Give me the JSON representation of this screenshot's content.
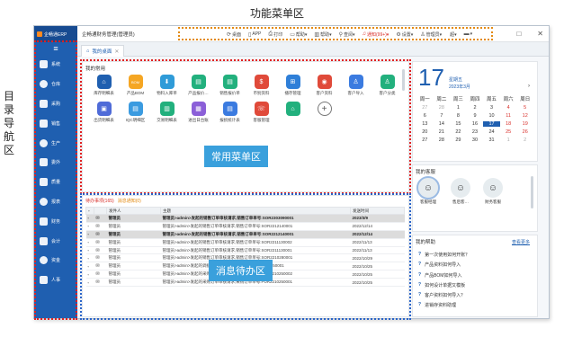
{
  "annotations": {
    "top_label": "功能菜单区",
    "left_label": "目录导航区",
    "common_menu_label": "常用菜单区",
    "message_label": "消息待办区"
  },
  "colors": {
    "sidebar": "#1f5fb0",
    "accent": "#1f5fb0",
    "overlay": "#3aa0dc",
    "highlight_row": "#dcdcdc",
    "red_border": "#e02020",
    "orange_border": "#e38a10",
    "blue_border": "#2a64c8"
  },
  "app_title": "企畅通ERP",
  "window_title": "企畅通财务管理(管理员)",
  "function_menu": [
    {
      "icon": "refresh-icon",
      "glyph": "⟳",
      "label": "桌面"
    },
    {
      "icon": "phone-icon",
      "glyph": "▯",
      "label": "APP"
    },
    {
      "icon": "printer-icon",
      "glyph": "⎙",
      "label": "打印"
    },
    {
      "icon": "folder-icon",
      "glyph": "▭",
      "label": "帮助▾"
    },
    {
      "icon": "chart-icon",
      "glyph": "▥",
      "label": "帮助▾"
    },
    {
      "icon": "search-icon",
      "glyph": "⚲",
      "label": "查阅▾"
    },
    {
      "icon": "bell-icon",
      "glyph": "♫",
      "label": "通知(99+)▾",
      "accent": true
    },
    {
      "icon": "gear-icon",
      "glyph": "⚙",
      "label": "设置▾"
    },
    {
      "icon": "user-icon",
      "glyph": "♙",
      "label": "管理员▾"
    },
    {
      "icon": "ellipsis-icon",
      "glyph": "",
      "label": "超▾"
    },
    {
      "icon": "flag-icon",
      "glyph": "▬",
      "label": "▾"
    }
  ],
  "window_controls": [
    "□",
    "✕"
  ],
  "sidebar": {
    "toggle": "≡",
    "items": [
      {
        "label": "系统",
        "icon": "system-icon"
      },
      {
        "label": "仓库",
        "icon": "warehouse-icon"
      },
      {
        "label": "采购",
        "icon": "purchase-icon"
      },
      {
        "label": "销售",
        "icon": "sales-icon"
      },
      {
        "label": "生产",
        "icon": "production-icon"
      },
      {
        "label": "委外",
        "icon": "outsource-icon"
      },
      {
        "label": "质量",
        "icon": "quality-icon"
      },
      {
        "label": "报表",
        "icon": "report-icon"
      },
      {
        "label": "财务",
        "icon": "finance-icon"
      },
      {
        "label": "会计",
        "icon": "accounting-icon"
      },
      {
        "label": "资金",
        "icon": "funds-icon"
      },
      {
        "label": "人事",
        "icon": "hr-icon"
      }
    ]
  },
  "tab": {
    "label": "我的桌面",
    "close": "✕"
  },
  "common": {
    "title": "我的常用",
    "apps": [
      {
        "label": "库存明细表",
        "color": "#1f5fb0",
        "icon": "inventory-icon",
        "glyph": "⌂"
      },
      {
        "label": "产品BOM",
        "color": "#f5a623",
        "icon": "bom-icon",
        "glyph": "BOM"
      },
      {
        "label": "物料入库单",
        "color": "#2f9bd8",
        "icon": "inbound-icon",
        "glyph": "⬇"
      },
      {
        "label": "产品报价…",
        "color": "#22b07d",
        "icon": "quote-icon",
        "glyph": "▤"
      },
      {
        "label": "销售报价单",
        "color": "#22b07d",
        "icon": "sales-quote-icon",
        "glyph": "▤"
      },
      {
        "label": "币别资料",
        "color": "#e04a3a",
        "icon": "currency-icon",
        "glyph": "$"
      },
      {
        "label": "播存管理",
        "color": "#2f7fd8",
        "icon": "windows-icon",
        "glyph": "⊞"
      },
      {
        "label": "客户资料",
        "color": "#e04a3a",
        "icon": "customer-icon",
        "glyph": "◉"
      },
      {
        "label": "客户导入",
        "color": "#3b7be0",
        "icon": "import-icon",
        "glyph": "♙"
      },
      {
        "label": "客户分类",
        "color": "#22b07d",
        "icon": "category-icon",
        "glyph": "♙"
      },
      {
        "label": "出货明细表",
        "color": "#4f6bd8",
        "icon": "shipment-icon",
        "glyph": "▣"
      },
      {
        "label": "IQC明细区",
        "color": "#3b9be0",
        "icon": "iqc-icon",
        "glyph": "▤"
      },
      {
        "label": "交易明细表",
        "color": "#22b07d",
        "icon": "trade-icon",
        "glyph": "▥"
      },
      {
        "label": "进出日台账",
        "color": "#8b5fd8",
        "icon": "ledger-icon",
        "glyph": "▦"
      },
      {
        "label": "报损统计表",
        "color": "#3b7be0",
        "icon": "loss-icon",
        "glyph": "▤"
      },
      {
        "label": "客服管理",
        "color": "#e04a3a",
        "icon": "service-icon",
        "glyph": "☏"
      },
      {
        "label": "",
        "color": "#22b07d",
        "icon": "lock-icon",
        "glyph": "⌂"
      },
      {
        "label": "",
        "color": "",
        "icon": "add-icon",
        "glyph": "+"
      }
    ]
  },
  "messages": {
    "tabs": [
      "待办事项(165)",
      "消息通知(0)"
    ],
    "columns": [
      "",
      "发件人",
      "主题",
      "发送时间"
    ],
    "rows": [
      {
        "sender": "管理员",
        "subject": "管理员>admin>发起的销售订单审核请求,销售订单单号:SOR2303090001",
        "date": "2023/3/9",
        "highlight": true
      },
      {
        "sender": "管理员",
        "subject": "管理员>admin>发起的销售订单审核请求,销售订单单号:SOR2212140001",
        "date": "2022/12/14",
        "highlight": false
      },
      {
        "sender": "管理员",
        "subject": "管理员>admin>发起的销售订单审核请求,销售订单单号:SOR2212140001",
        "date": "2022/12/14",
        "highlight": true
      },
      {
        "sender": "管理员",
        "subject": "管理员>admin>发起的销售订单审核请求,销售订单单号:SOR2211130002",
        "date": "2022/11/13",
        "highlight": false
      },
      {
        "sender": "管理员",
        "subject": "管理员>admin>发起的销售订单审核请求,销售订单单号:SOR2211130001",
        "date": "2022/11/13",
        "highlight": false
      },
      {
        "sender": "管理员",
        "subject": "管理员>admin>发起的销售订单审核请求,销售订单单号:SOR2210280001",
        "date": "2022/10/29",
        "highlight": false
      },
      {
        "sender": "管理员",
        "subject": "管理员>admin>发起的调拨单审核请求,调拨单单号:PRK2210250001",
        "date": "2022/10/25",
        "highlight": false
      },
      {
        "sender": "管理员",
        "subject": "管理员>admin>发起的采购订单审核请求,采购订单单号:PUR2210250002",
        "date": "2022/10/25",
        "highlight": false
      },
      {
        "sender": "管理员",
        "subject": "管理员>admin>发起的采购订单审核请求,采购订单单号:PUR2210250001",
        "date": "2022/10/25",
        "highlight": false
      }
    ]
  },
  "calendar": {
    "day": "17",
    "weekday": "星期五",
    "year_month": "2023年3月",
    "next": "›",
    "headers": [
      "周一",
      "周二",
      "周三",
      "周四",
      "周五",
      "周六",
      "周日"
    ],
    "days": [
      [
        "27",
        "o"
      ],
      [
        "28",
        "o"
      ],
      [
        "1",
        ""
      ],
      [
        "2",
        ""
      ],
      [
        "3",
        ""
      ],
      [
        "4",
        "w"
      ],
      [
        "5",
        "w"
      ],
      [
        "6",
        ""
      ],
      [
        "7",
        ""
      ],
      [
        "8",
        ""
      ],
      [
        "9",
        ""
      ],
      [
        "10",
        ""
      ],
      [
        "11",
        "w"
      ],
      [
        "12",
        "w"
      ],
      [
        "13",
        ""
      ],
      [
        "14",
        ""
      ],
      [
        "15",
        ""
      ],
      [
        "16",
        ""
      ],
      [
        "17",
        "t"
      ],
      [
        "18",
        "w"
      ],
      [
        "19",
        "w"
      ],
      [
        "20",
        ""
      ],
      [
        "21",
        ""
      ],
      [
        "22",
        ""
      ],
      [
        "23",
        ""
      ],
      [
        "24",
        ""
      ],
      [
        "25",
        "w"
      ],
      [
        "26",
        "w"
      ],
      [
        "27",
        ""
      ],
      [
        "28",
        ""
      ],
      [
        "29",
        ""
      ],
      [
        "30",
        ""
      ],
      [
        "31",
        ""
      ],
      [
        "1",
        "o"
      ],
      [
        "2",
        "o"
      ]
    ]
  },
  "guests": {
    "title": "我的客服",
    "items": [
      {
        "name": "客服经理",
        "selected": true
      },
      {
        "name": "售后客…",
        "selected": false
      },
      {
        "name": "财务客服",
        "selected": false
      }
    ]
  },
  "help": {
    "title": "我的帮助",
    "more": "查看更多",
    "items": [
      "第一次使用如何开账？",
      "产品资料如何导入",
      "产品BOM如何导入",
      "如何设计单据又模板",
      "客户资料如何导入？",
      "进销存资料助理"
    ]
  }
}
